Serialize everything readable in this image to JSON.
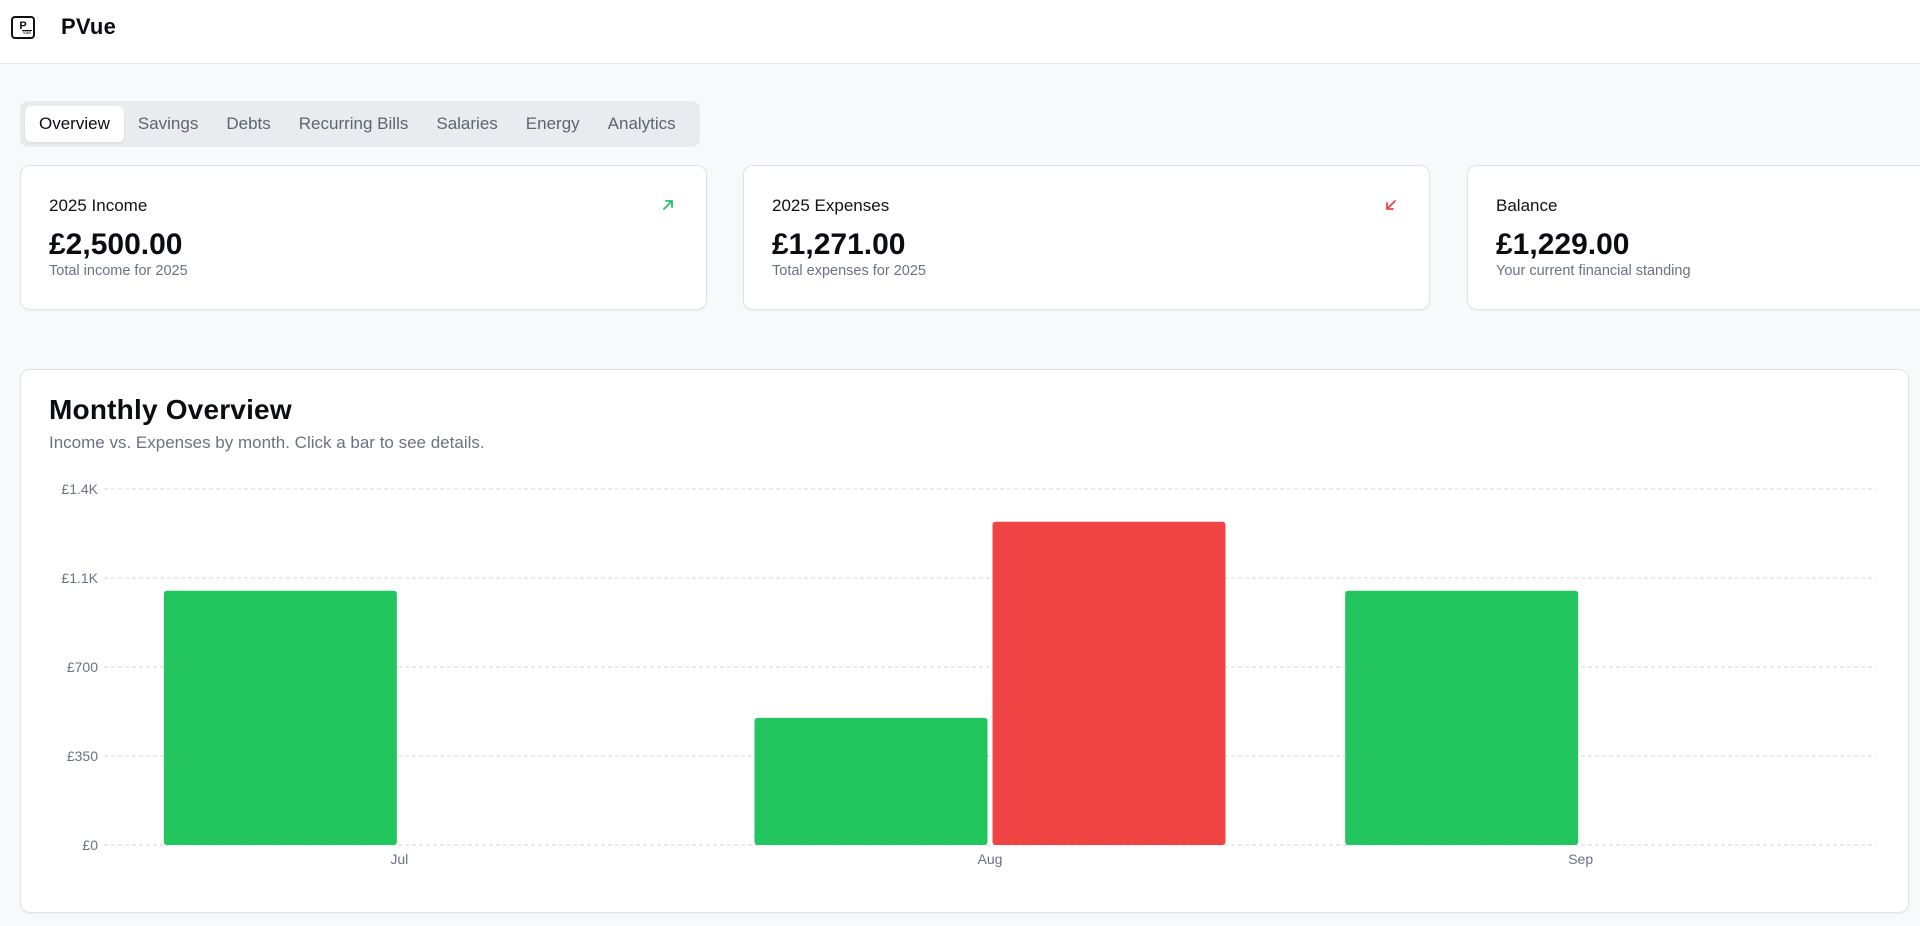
{
  "app": {
    "title": "PVue",
    "logo_letter": "P",
    "logo_sub": "vue"
  },
  "tabs": [
    {
      "label": "Overview",
      "active": true
    },
    {
      "label": "Savings",
      "active": false
    },
    {
      "label": "Debts",
      "active": false
    },
    {
      "label": "Recurring Bills",
      "active": false
    },
    {
      "label": "Salaries",
      "active": false
    },
    {
      "label": "Energy",
      "active": false
    },
    {
      "label": "Analytics",
      "active": false
    }
  ],
  "stats": [
    {
      "title": "2025 Income",
      "value": "£2,500.00",
      "desc": "Total income for 2025",
      "icon": "arrow-up-right-icon",
      "icon_color": "#22c55e"
    },
    {
      "title": "2025 Expenses",
      "value": "£1,271.00",
      "desc": "Total expenses for 2025",
      "icon": "arrow-down-left-icon",
      "icon_color": "#ef4444"
    },
    {
      "title": "Balance",
      "value": "£1,229.00",
      "desc": "Your current financial standing",
      "icon": "",
      "icon_color": ""
    }
  ],
  "chart": {
    "title": "Monthly Overview",
    "subtitle": "Income vs. Expenses by month. Click a bar to see details."
  },
  "chart_data": {
    "type": "bar",
    "categories": [
      "Jul",
      "Aug",
      "Sep"
    ],
    "series": [
      {
        "name": "",
        "color": "#22c55e",
        "values": [
          1000,
          500,
          1000
        ]
      },
      {
        "name": "",
        "color": "#ef4444",
        "values": [
          0,
          1271,
          0
        ]
      }
    ],
    "yticks": [
      "£0",
      "£350",
      "£700",
      "£1.1K",
      "£1.4K"
    ],
    "ytick_values": [
      0,
      350,
      700,
      1050,
      1400
    ],
    "ylim": [
      0,
      1400
    ],
    "grid": true,
    "xlabel": "",
    "ylabel": ""
  }
}
